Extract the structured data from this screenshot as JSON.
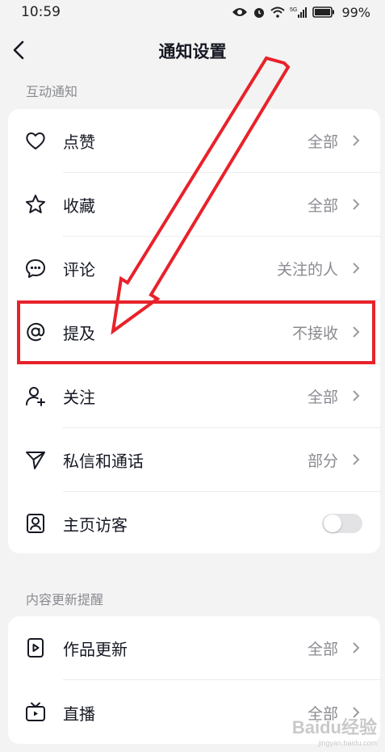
{
  "status_bar": {
    "time": "10:59",
    "battery": "99%",
    "icons": [
      "eye-icon",
      "alarm-icon",
      "wifi-icon",
      "signal-5g-icon",
      "battery-icon"
    ]
  },
  "header": {
    "title": "通知设置",
    "back_icon": "back-chevron-icon"
  },
  "sections": {
    "interaction": {
      "title": "互动通知",
      "items": [
        {
          "icon": "heart-icon",
          "label": "点赞",
          "value": "全部"
        },
        {
          "icon": "star-icon",
          "label": "收藏",
          "value": "全部"
        },
        {
          "icon": "comment-icon",
          "label": "评论",
          "value": "关注的人"
        },
        {
          "icon": "at-icon",
          "label": "提及",
          "value": "不接收"
        },
        {
          "icon": "follow-user-icon",
          "label": "关注",
          "value": "全部"
        },
        {
          "icon": "send-icon",
          "label": "私信和通话",
          "value": "部分"
        },
        {
          "icon": "profile-visitor-icon",
          "label": "主页访客",
          "toggle": false
        }
      ]
    },
    "content_updates": {
      "title": "内容更新提醒",
      "items": [
        {
          "icon": "video-play-icon",
          "label": "作品更新",
          "value": "全部"
        },
        {
          "icon": "live-tv-icon",
          "label": "直播",
          "value": "全部"
        }
      ]
    }
  },
  "annotation": {
    "highlight_color": "#e8222b",
    "highlighted_item": "提及"
  },
  "watermark": {
    "text": "Baidu经验",
    "subtext": "jingyan.baidu.com"
  }
}
